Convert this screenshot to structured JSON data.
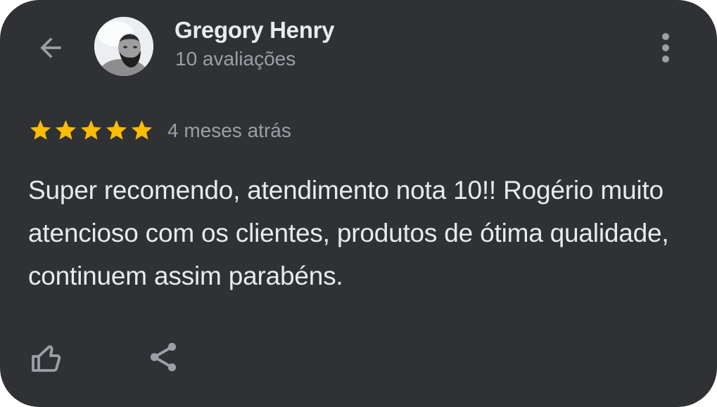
{
  "header": {
    "back_icon": "arrow-back-icon",
    "reviewer_name": "Gregory Henry",
    "review_count": "10 avaliações",
    "more_icon": "more-vert-icon"
  },
  "review": {
    "rating": 5,
    "rating_max": 5,
    "star_color": "#fbbc04",
    "time_ago": "4 meses atrás",
    "text": "Super recomendo, atendimento nota 10!! Rogério muito atencioso com os clientes, produtos de ótima qualidade, continuem assim parabéns."
  },
  "actions": {
    "like_icon": "thumb-up-icon",
    "share_icon": "share-icon"
  },
  "colors": {
    "background": "#303134",
    "primary_text": "#e8eaed",
    "secondary_text": "#9aa0a6"
  }
}
